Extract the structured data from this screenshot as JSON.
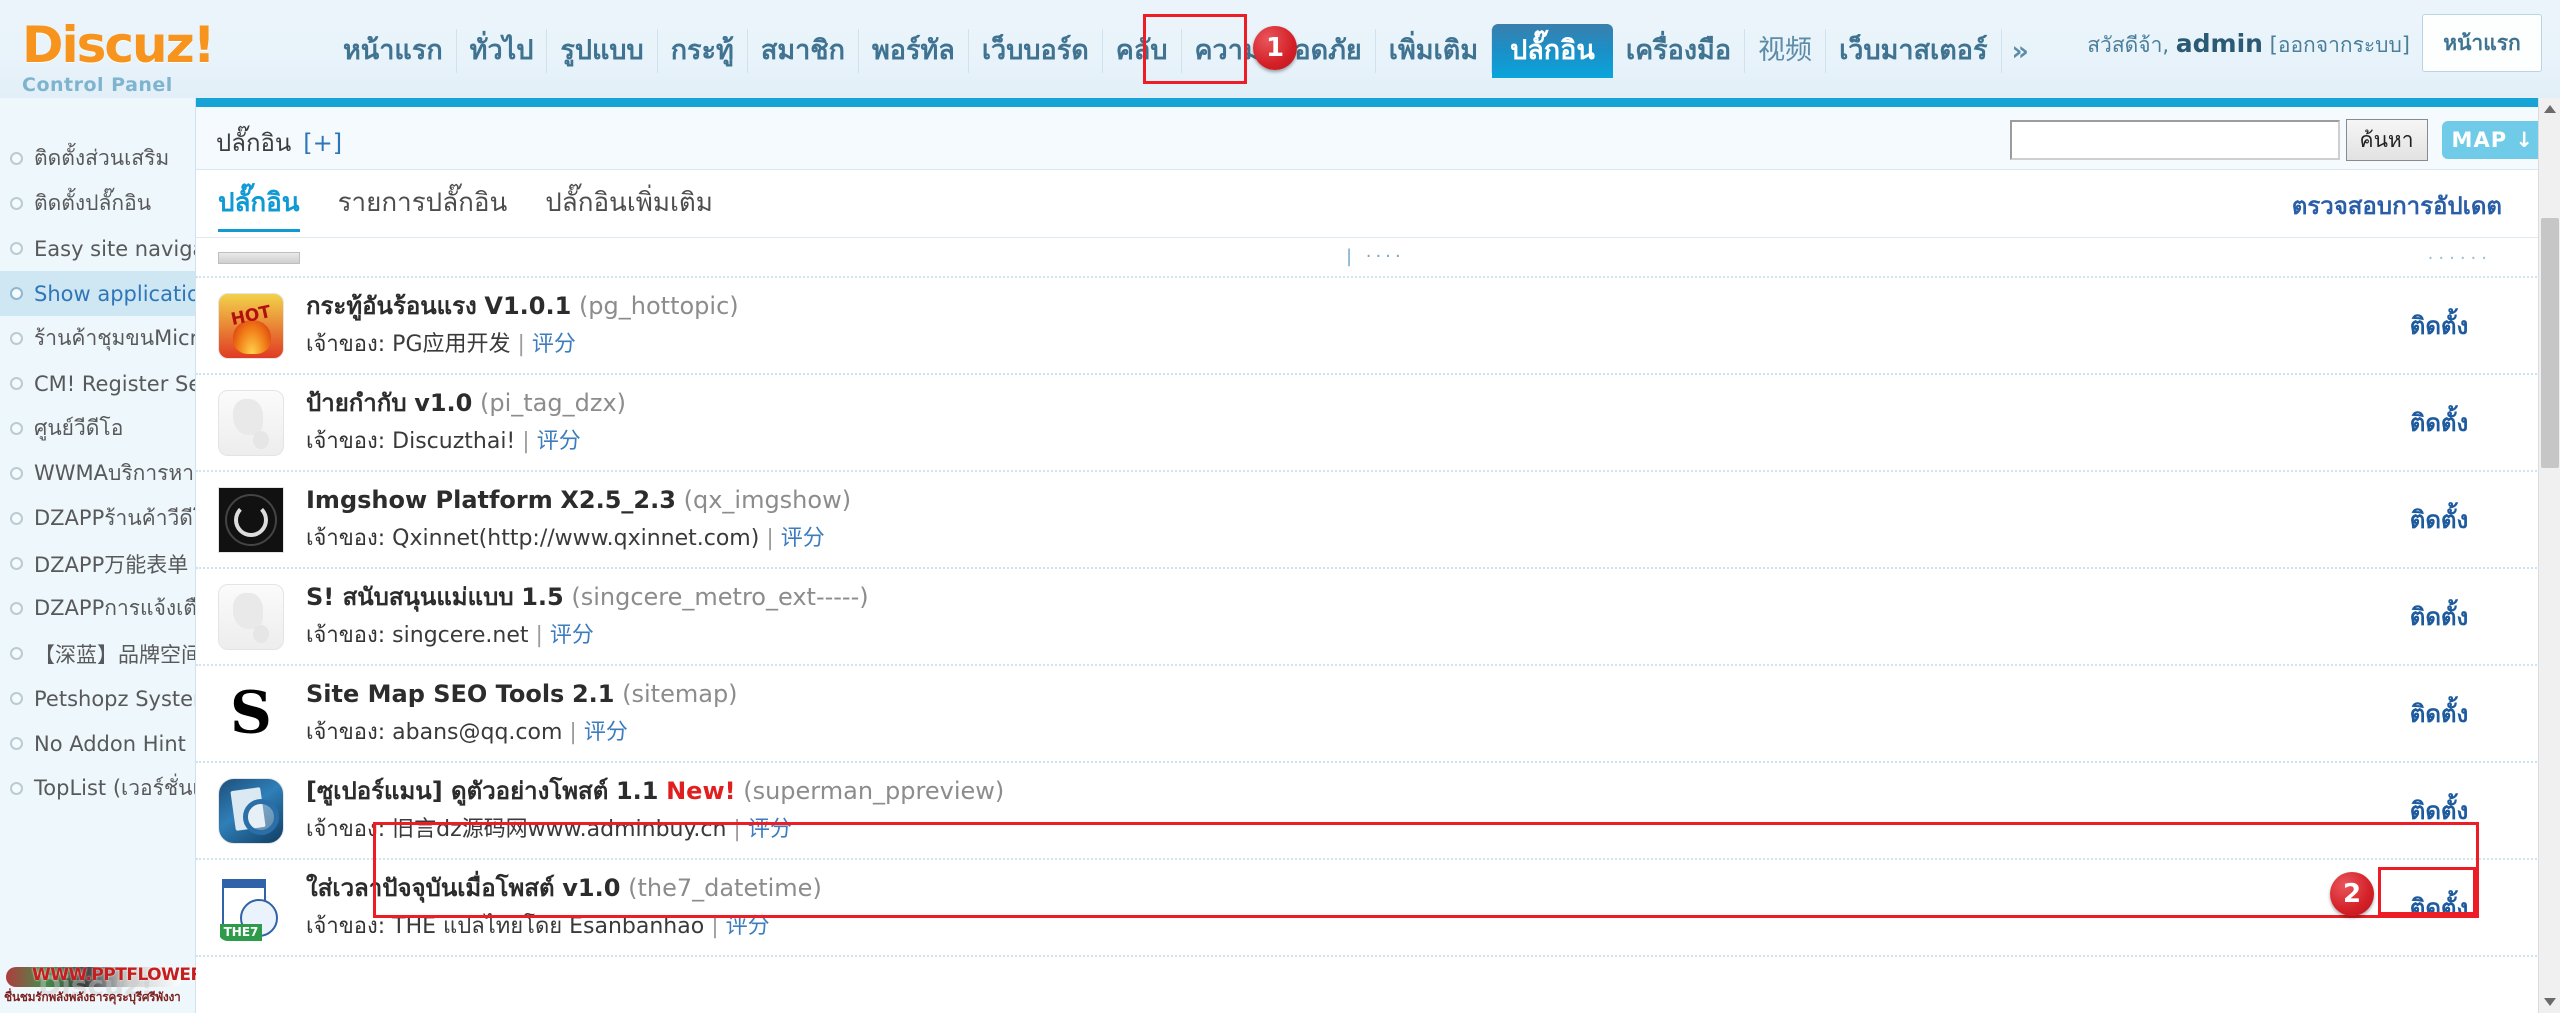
{
  "header": {
    "logo_main": "Discuz!",
    "logo_sub": "Control Panel",
    "nav_items": [
      {
        "label": "หน้าแรก",
        "cjk": false,
        "active": false
      },
      {
        "label": "ทั่วไป",
        "cjk": false,
        "active": false
      },
      {
        "label": "รูปแบบ",
        "cjk": false,
        "active": false
      },
      {
        "label": "กระทู้",
        "cjk": false,
        "active": false
      },
      {
        "label": "สมาชิก",
        "cjk": false,
        "active": false
      },
      {
        "label": "พอร์ทัล",
        "cjk": false,
        "active": false
      },
      {
        "label": "เว็บบอร์ด",
        "cjk": false,
        "active": false
      },
      {
        "label": "คลับ",
        "cjk": false,
        "active": false
      },
      {
        "label": "ความปลอดภัย",
        "cjk": false,
        "active": false
      },
      {
        "label": "เพิ่มเติม",
        "cjk": false,
        "active": false
      },
      {
        "label": "ปลั๊กอิน",
        "cjk": false,
        "active": true
      },
      {
        "label": "เครื่องมือ",
        "cjk": false,
        "active": false
      },
      {
        "label": "视频",
        "cjk": true,
        "active": false
      },
      {
        "label": "เว็บมาสเตอร์",
        "cjk": false,
        "active": false
      }
    ],
    "nav_more": "»",
    "greeting": "สวัสดีจ้า,",
    "username": "admin",
    "logout": "[ออกจากระบบ]",
    "home_button": "หน้าแรก"
  },
  "annotations": [
    {
      "id": "1",
      "target": "plugin-nav-tab"
    },
    {
      "id": "2",
      "target": "superman-install-button"
    }
  ],
  "sidebar": {
    "items": [
      {
        "label": "ติดตั้งส่วนเสริม",
        "selected": false
      },
      {
        "label": "ติดตั้งปลั๊กอิน",
        "selected": false
      },
      {
        "label": "Easy site navigation",
        "selected": false
      },
      {
        "label": "Show applications po",
        "selected": true
      },
      {
        "label": "ร้านค้าชุมขนMicro Stor",
        "selected": false
      },
      {
        "label": "CM! Register Set Ava",
        "selected": false
      },
      {
        "label": "ศูนย์วีดีโอ",
        "selected": false
      },
      {
        "label": "WWMAบริการหาเพื่อนออ",
        "selected": false
      },
      {
        "label": "DZAPPร้านค้าวีดีโอ",
        "selected": false
      },
      {
        "label": "DZAPP万能表单",
        "selected": false
      },
      {
        "label": "DZAPPการแจ้งเตือนอีเม",
        "selected": false
      },
      {
        "label": "【深蓝】品牌空间",
        "selected": false
      },
      {
        "label": "Petshopz System",
        "selected": false
      },
      {
        "label": "No Addon Hint",
        "selected": false
      },
      {
        "label": "TopList (เวอร์ชั่นเสียตัง)",
        "selected": false
      }
    ],
    "watermark": {
      "text": "WWW.PPTFLOWER.COM",
      "sub": "ชื่นชมรักพลังพลังธารคุระบุรีศรีพังงา",
      "ghost": "Discuz!"
    }
  },
  "subbar": {
    "breadcrumb": "ปลั๊กอิน",
    "breadcrumb_plus": "[+]",
    "search_value": "",
    "search_placeholder": "",
    "search_button": "ค้นหา",
    "map_button": "MAP ↓"
  },
  "tabs": [
    {
      "label": "ปลั๊กอิน",
      "active": true
    },
    {
      "label": "รายการปลั๊กอิน",
      "active": false
    },
    {
      "label": "ปลั๊กอินเพิ่มเติม",
      "active": false
    }
  ],
  "check_updates_label": "ตรวจสอบการอัปเดต",
  "owner_label": "เจ้าของ:",
  "rate_label": "评分",
  "install_label": "ติดตั้ง",
  "plugins": [
    {
      "name": "กระทู้อันร้อนแรง",
      "version": "V1.0.1",
      "new": "",
      "slug": "(pg_hottopic)",
      "owner": "PG应用开发",
      "icon": "hot-fire-icon",
      "action": "ติดตั้ง",
      "highlighted": false
    },
    {
      "name": "ป้ายกำกับ",
      "version": "v1.0",
      "new": "",
      "slug": "(pi_tag_dzx)",
      "owner": "Discuzthai!",
      "icon": "blank-placeholder-icon",
      "action": "ติดตั้ง",
      "highlighted": false
    },
    {
      "name": "Imgshow Platform",
      "version": "X2.5_2.3",
      "new": "",
      "slug": "(qx_imgshow)",
      "owner": "Qxinnet(http://www.qxinnet.com)",
      "icon": "imgshow-dark-icon",
      "action": "ติดตั้ง",
      "highlighted": false
    },
    {
      "name": "S! สนับสนุนแม่แบบ",
      "version": "1.5",
      "new": "",
      "slug": "(singcere_metro_ext-----)",
      "owner": "singcere.net",
      "icon": "blank-placeholder-icon",
      "action": "ติดตั้ง",
      "highlighted": false
    },
    {
      "name": "Site Map SEO Tools",
      "version": "2.1",
      "new": "",
      "slug": "(sitemap)",
      "owner": "abans@qq.com",
      "icon": "sitemap-s-icon",
      "action": "ติดตั้ง",
      "highlighted": false
    },
    {
      "name": "[ซูเปอร์แมน] ดูตัวอย่างโพสต์",
      "version": "1.1",
      "new": "New!",
      "slug": "(superman_ppreview)",
      "owner": "旧言dz源码网www.adminbuy.cn",
      "icon": "superman-preview-icon",
      "action": "ติดตั้ง",
      "highlighted": true
    },
    {
      "name": "ใส่เวลาปัจจุบันเมื่อโพสต์",
      "version": "v1.0",
      "new": "",
      "slug": "(the7_datetime)",
      "owner": "THE แปลไทยโดย Esanbanhao",
      "icon": "calendar-clock-icon",
      "action": "ติดตั้ง",
      "highlighted": false
    }
  ]
}
